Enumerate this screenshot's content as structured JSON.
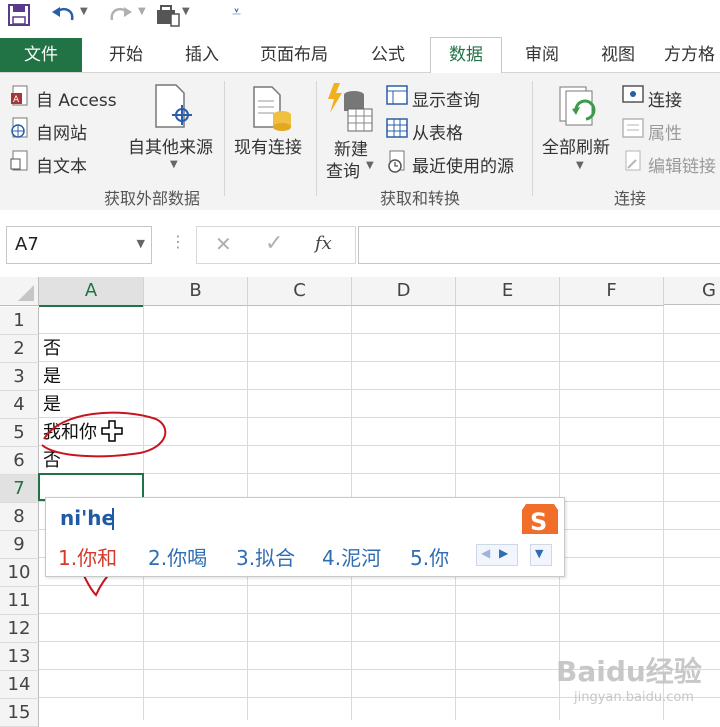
{
  "quick_access": {
    "icons": [
      "save-icon",
      "undo-icon",
      "redo-icon",
      "touch-mode-icon",
      "customize-icon"
    ]
  },
  "tabs": [
    {
      "label": "文件"
    },
    {
      "label": "开始"
    },
    {
      "label": "插入"
    },
    {
      "label": "页面布局"
    },
    {
      "label": "公式"
    },
    {
      "label": "数据"
    },
    {
      "label": "审阅"
    },
    {
      "label": "视图"
    },
    {
      "label": "方方格"
    }
  ],
  "ribbon": {
    "external": {
      "access": "自 Access",
      "web": "自网站",
      "text": "自文本",
      "other": "自其他来源",
      "existing": "现有连接",
      "group": "获取外部数据"
    },
    "transform": {
      "new_query_line1": "新建",
      "new_query_line2": "查询",
      "show_queries": "显示查询",
      "from_table": "从表格",
      "recent_sources": "最近使用的源",
      "group": "获取和转换"
    },
    "connections": {
      "refresh_all": "全部刷新",
      "connections": "连接",
      "properties": "属性",
      "edit_links": "编辑链接",
      "group": "连接"
    }
  },
  "formula_bar": {
    "name_box": "A7",
    "fx": "fx",
    "formula": ""
  },
  "grid": {
    "columns": [
      "A",
      "B",
      "C",
      "D",
      "E",
      "F",
      "G"
    ],
    "rows": [
      "1",
      "2",
      "3",
      "4",
      "5",
      "6",
      "7",
      "8",
      "9",
      "10",
      "11",
      "12",
      "13",
      "14",
      "15"
    ],
    "cells": {
      "A2": "否",
      "A3": "是",
      "A4": "是",
      "A5": "我和你",
      "A6": "否"
    }
  },
  "ime": {
    "pinyin": "ni'he",
    "candidates": [
      "1.你和",
      "2.你喝",
      "3.拟合",
      "4.泥河",
      "5.你"
    ]
  },
  "watermark": {
    "line1": "Baidu经验",
    "line2": "jingyan.baidu.com"
  },
  "colors": {
    "excel_green": "#217346",
    "annotation_red": "#c8141e",
    "ime_blue": "#2f6db3",
    "ime_red": "#d33a2c",
    "sogou_orange": "#f06d2a"
  }
}
